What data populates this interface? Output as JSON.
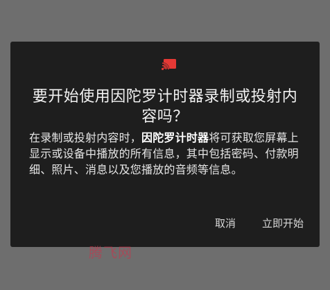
{
  "dialog": {
    "icon": "cast-screen-icon",
    "accent_color": "#e53935",
    "title": "要开始使用因陀罗计时器录制或投射内容吗？",
    "message": {
      "part1": "在录制或投射内容时，",
      "app_name": "因陀罗计时器",
      "part2": "将可获取您屏幕上显示或设备中播放的所有信息，其中包括密码、付款明细、照片、消息以及您播放的音频等信息。"
    },
    "cancel_label": "取消",
    "start_label": "立即开始"
  },
  "watermark": "腾飞网"
}
